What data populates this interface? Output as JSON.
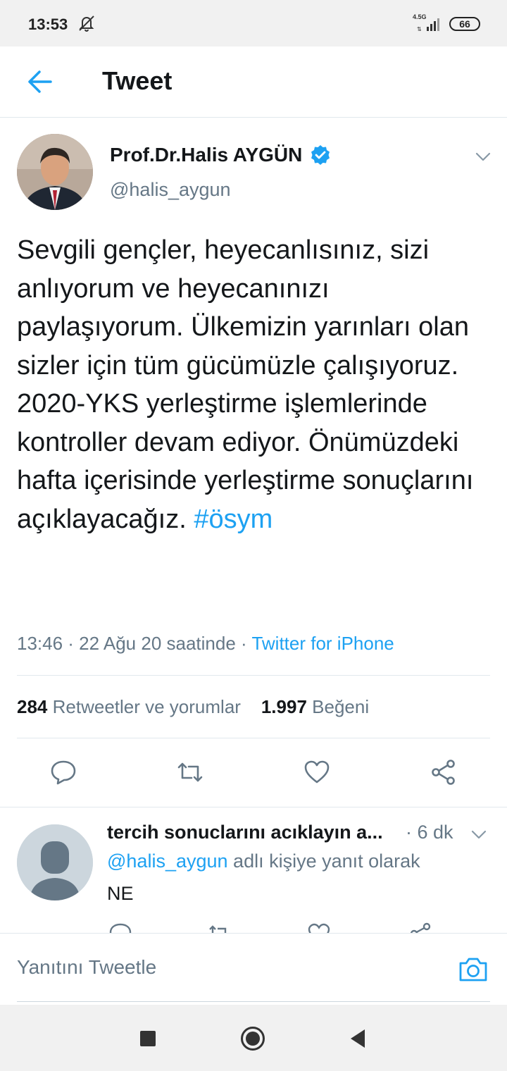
{
  "status_bar": {
    "time": "13:53",
    "network": "4.5G",
    "battery": "66"
  },
  "header": {
    "title": "Tweet"
  },
  "tweet": {
    "author_name": "Prof.Dr.Halis AYGÜN",
    "author_handle": "@halis_aygun",
    "verified": true,
    "text": "Sevgili gençler, heyecanlısınız, sizi anlıyorum ve heyecanınızı paylaşıyorum. Ülkemizin yarınları olan sizler için tüm gücümüzle çalışıyoruz. 2020-YKS yerleştirme işlemlerinde kontroller devam ediyor. Önümüzdeki hafta içerisinde yerleştirme sonuçlarını açıklayacağız.",
    "hashtag": "#ösym",
    "timestamp": "13:46 · 22 Ağu 20 saatinde · ",
    "source": "Twitter for iPhone",
    "retweets_count": "284",
    "retweets_label": "Retweetler ve yorumlar",
    "likes_count": "1.997",
    "likes_label": "Beğeni"
  },
  "reply": {
    "name": "tercih sonuclarını acıklayın a...",
    "time": "· 6 dk",
    "mention": "@halis_aygun",
    "reply_to_suffix": "adlı kişiye yanıt olarak",
    "text": "NE"
  },
  "compose": {
    "placeholder": "Yanıtını Tweetle"
  },
  "colors": {
    "accent": "#1da1f2",
    "secondary_text": "#657786",
    "primary_text": "#14171a"
  }
}
